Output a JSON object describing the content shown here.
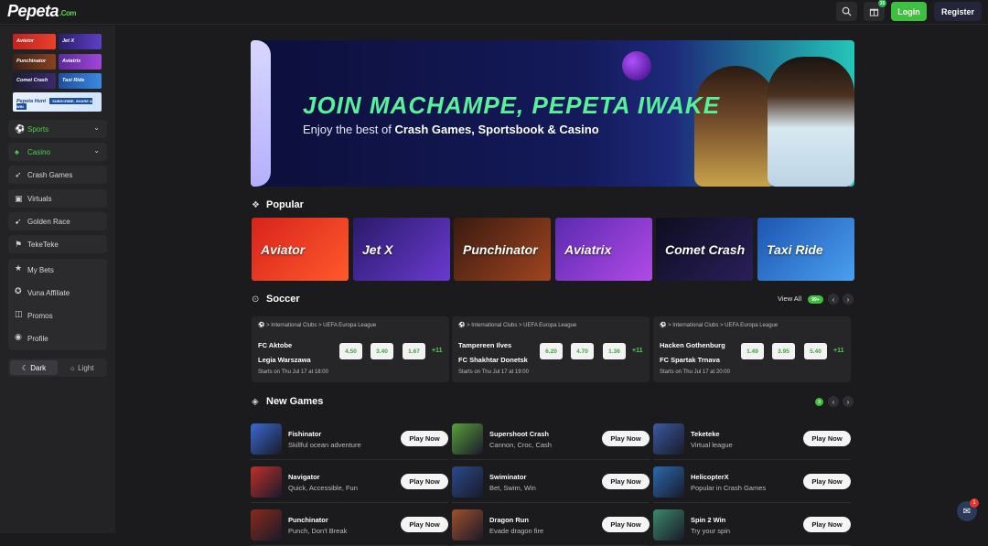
{
  "brand": {
    "name": "Pepeta",
    "domain": ".Com",
    "accent": "#3fbf3f"
  },
  "topbar": {
    "search_icon": "search-icon",
    "gift_icon": "gift-icon",
    "gift_badge": "15",
    "login_label": "Login",
    "register_label": "Register"
  },
  "sidebar": {
    "games": [
      {
        "label": "Aviator"
      },
      {
        "label": "Jet X"
      },
      {
        "label": "Punchinator"
      },
      {
        "label": "Aviatrix"
      },
      {
        "label": "Comet Crash"
      },
      {
        "label": "Taxi Ride"
      }
    ],
    "promo": {
      "label": "Pepeta Hunt",
      "sub": "SUBSCRIBE, SHARE & WIN"
    },
    "items": [
      {
        "label": "Sports",
        "icon": "soccer-icon"
      },
      {
        "label": "Casino",
        "icon": "cards-icon"
      },
      {
        "label": "Crash Games",
        "icon": "rocket-icon"
      },
      {
        "label": "Virtuals",
        "icon": "virtuals-icon"
      },
      {
        "label": "Golden Race",
        "icon": "race-icon"
      },
      {
        "label": "TekeTeke",
        "icon": "teketeke-icon"
      }
    ],
    "account": [
      {
        "label": "My Bets",
        "icon": "star-icon"
      },
      {
        "label": "Vuna Affiliate",
        "icon": "affiliate-icon"
      },
      {
        "label": "Promos",
        "icon": "gift-icon"
      },
      {
        "label": "Profile",
        "icon": "profile-icon"
      }
    ],
    "theme": {
      "dark": "Dark",
      "light": "Light"
    }
  },
  "hero": {
    "title": "JOIN MACHAMPE, PEPETA IWAKE",
    "sub_prefix": "Enjoy the best of ",
    "sub_bold": "Crash Games, Sportsbook & Casino"
  },
  "popular": {
    "title": "Popular",
    "cards": [
      {
        "label": "Aviator"
      },
      {
        "label": "Jet X"
      },
      {
        "label": "Punchinator"
      },
      {
        "label": "Aviatrix"
      },
      {
        "label": "Comet Crash"
      },
      {
        "label": "Taxi Ride"
      }
    ]
  },
  "soccer": {
    "title": "Soccer",
    "view_all": "View All",
    "count_badge": "99+",
    "matches": [
      {
        "path": "> International Clubs  >  UEFA Europa League",
        "home": "FC Aktobe",
        "away": "Legia Warszawa",
        "odds": [
          "4.50",
          "3.40",
          "1.67"
        ],
        "more": "+11",
        "start": "Starts on Thu Jul 17 at 18:00"
      },
      {
        "path": "> International Clubs  >  UEFA Europa League",
        "home": "Tampereen Ilves",
        "away": "FC Shakhtar Donetsk",
        "odds": [
          "6.20",
          "4.70",
          "1.36"
        ],
        "more": "+11",
        "start": "Starts on Thu Jul 17 at 19:00"
      },
      {
        "path": "> International Clubs  >  UEFA Europa League",
        "home": "Hacken Gothenburg",
        "away": "FC Spartak Trnava",
        "odds": [
          "1.49",
          "3.95",
          "5.40"
        ],
        "more": "+11",
        "start": "Starts on Thu Jul 17 at 20:00"
      }
    ]
  },
  "new_games": {
    "title": "New Games",
    "count_badge": "9",
    "play_label": "Play Now",
    "items": [
      {
        "name": "Fishinator",
        "desc": "Skillful ocean adventure",
        "color": "#3a6ad0"
      },
      {
        "name": "Supershoot Crash",
        "desc": "Cannon, Croc, Cash",
        "color": "#5aa03a"
      },
      {
        "name": "Teketeke",
        "desc": "Virtual league",
        "color": "#3a5aa0"
      },
      {
        "name": "Navigator",
        "desc": "Quick, Accessible, Fun",
        "color": "#c0302a"
      },
      {
        "name": "Swiminator",
        "desc": "Bet, Swim, Win",
        "color": "#2a4a8a"
      },
      {
        "name": "HelicopterX",
        "desc": "Popular in Crash Games",
        "color": "#2a6ab0"
      },
      {
        "name": "Punchinator",
        "desc": "Punch, Don't Break",
        "color": "#8a2a1a"
      },
      {
        "name": "Dragon Run",
        "desc": "Evade dragon fire",
        "color": "#a0502a"
      },
      {
        "name": "Spin 2 Win",
        "desc": "Try your spin",
        "color": "#3a8a6a"
      }
    ]
  },
  "chat": {
    "badge": "1"
  }
}
